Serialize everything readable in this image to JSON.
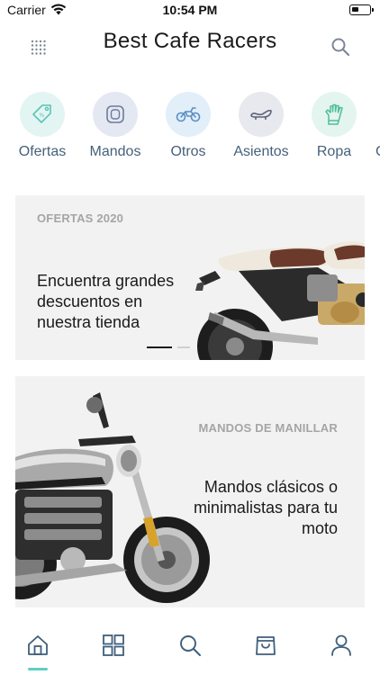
{
  "status_bar": {
    "carrier": "Carrier",
    "time": "10:54 PM"
  },
  "header": {
    "title": "Best Cafe Racers",
    "menu_icon": "grid-dots-icon",
    "search_icon": "search-icon"
  },
  "categories": [
    {
      "label": "Ofertas",
      "icon": "price-tag-icon",
      "bg": "#e3f5f2",
      "color": "#5bc4b8"
    },
    {
      "label": "Mandos",
      "icon": "grip-icon",
      "bg": "#e4e8f2",
      "color": "#6c7c99"
    },
    {
      "label": "Otros",
      "icon": "motorcycle-icon",
      "bg": "#e2eef8",
      "color": "#5a8fc4"
    },
    {
      "label": "Asientos",
      "icon": "seat-icon",
      "bg": "#e8e9ee",
      "color": "#5c6478"
    },
    {
      "label": "Ropa",
      "icon": "glove-icon",
      "bg": "#e3f5ee",
      "color": "#4fbf96"
    }
  ],
  "banners": [
    {
      "eyebrow": "OFERTAS 2020",
      "headline": "Encuentra grandes descuentos en nuestra tienda"
    },
    {
      "eyebrow": "MANDOS DE MANILLAR",
      "headline": "Mandos clásicos o minimalistas para tu moto"
    }
  ],
  "bottom_nav": [
    {
      "icon": "home-icon",
      "active": true
    },
    {
      "icon": "categories-icon",
      "active": false
    },
    {
      "icon": "search-icon",
      "active": false
    },
    {
      "icon": "cart-icon",
      "active": false
    },
    {
      "icon": "profile-icon",
      "active": false
    }
  ],
  "colors": {
    "accent": "#5fcfc4",
    "nav_icon": "#3f5f7a",
    "card_bg": "#f2f2f3"
  }
}
